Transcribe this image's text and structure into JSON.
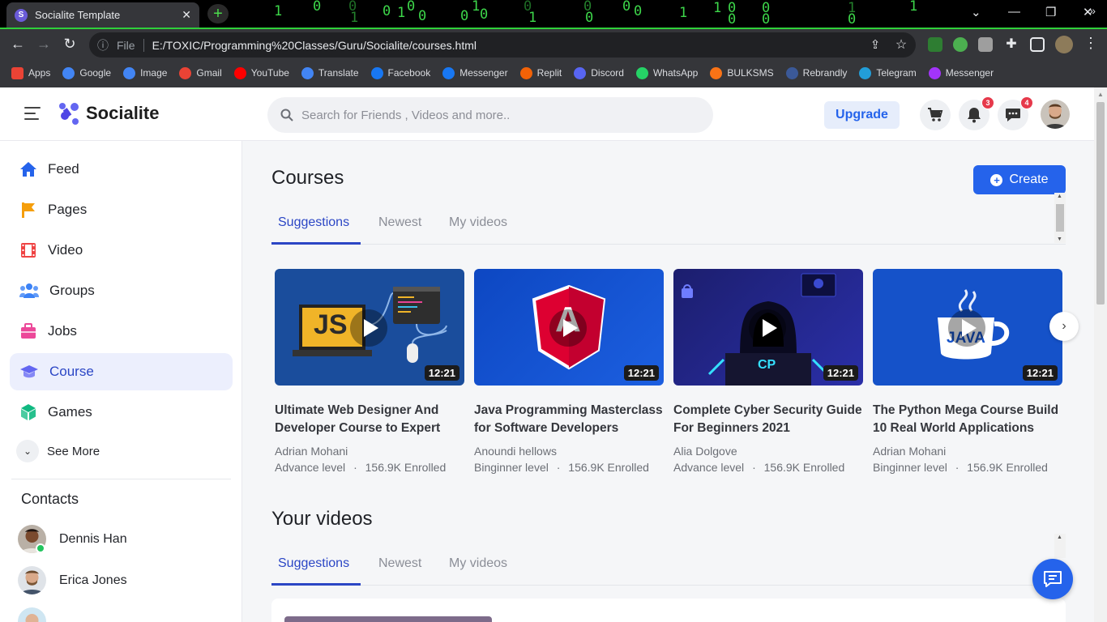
{
  "browser": {
    "tab_title": "Socialite Template",
    "tab_favicon_letter": "S",
    "url_scheme": "File",
    "url": "E:/TOXIC/Programming%20Classes/Guru/Socialite/courses.html",
    "bookmarks": [
      {
        "label": "Apps",
        "color": "#ea4335"
      },
      {
        "label": "Google",
        "color": "#4285f4"
      },
      {
        "label": "Image",
        "color": "#4285f4"
      },
      {
        "label": "Gmail",
        "color": "#ea4335"
      },
      {
        "label": "YouTube",
        "color": "#ff0000"
      },
      {
        "label": "Translate",
        "color": "#4285f4"
      },
      {
        "label": "Facebook",
        "color": "#1877f2"
      },
      {
        "label": "Messenger",
        "color": "#1877f2"
      },
      {
        "label": "Replit",
        "color": "#f26207"
      },
      {
        "label": "Discord",
        "color": "#5865f2"
      },
      {
        "label": "WhatsApp",
        "color": "#25d366"
      },
      {
        "label": "BULKSMS",
        "color": "#f97316"
      },
      {
        "label": "Rebrandly",
        "color": "#3b5998"
      },
      {
        "label": "Telegram",
        "color": "#229ed9"
      },
      {
        "label": "Messenger",
        "color": "#a334fa"
      }
    ],
    "more_glyph": "»"
  },
  "header": {
    "brand": "Socialite",
    "search_placeholder": "Search for Friends , Videos and more..",
    "upgrade_label": "Upgrade",
    "notifications_count": "3",
    "messages_count": "4"
  },
  "sidebar": {
    "items": [
      {
        "label": "Feed",
        "icon": "home-icon",
        "color": "#2563eb"
      },
      {
        "label": "Pages",
        "icon": "flag-icon",
        "color": "#f59e0b"
      },
      {
        "label": "Video",
        "icon": "film-icon",
        "color": "#ef4444"
      },
      {
        "label": "Groups",
        "icon": "users-icon",
        "color": "#3b82f6"
      },
      {
        "label": "Jobs",
        "icon": "briefcase-icon",
        "color": "#ec4899"
      },
      {
        "label": "Course",
        "icon": "graduation-cap-icon",
        "color": "#6366f1"
      },
      {
        "label": "Games",
        "icon": "cube-icon",
        "color": "#10b981"
      }
    ],
    "active_index": 5,
    "see_more_label": "See More",
    "contacts_title": "Contacts",
    "contacts": [
      {
        "name": "Dennis Han",
        "online": true
      },
      {
        "name": "Erica Jones",
        "online": false
      }
    ]
  },
  "main": {
    "courses_title": "Courses",
    "create_label": "Create",
    "tabs": [
      "Suggestions",
      "Newest",
      "My videos"
    ],
    "courses": [
      {
        "title": "Ultimate Web Designer And Developer Course to Expert",
        "author": "Adrian Mohani",
        "level": "Advance level",
        "enrolled": "156.9K Enrolled",
        "duration": "12:21",
        "thumb_text": "JS"
      },
      {
        "title": "Java Programming Masterclass for Software Developers",
        "author": "Anoundi hellows",
        "level": "Binginner level",
        "enrolled": "156.9K Enrolled",
        "duration": "12:21",
        "thumb_text": "A"
      },
      {
        "title": "Complete Cyber Security Guide For Beginners 2021",
        "author": "Alia Dolgove",
        "level": "Advance level",
        "enrolled": "156.9K Enrolled",
        "duration": "12:21",
        "thumb_text": "CP"
      },
      {
        "title": "The Python Mega Course Build 10 Real World Applications",
        "author": "Adrian Mohani",
        "level": "Binginner level",
        "enrolled": "156.9K Enrolled",
        "duration": "12:21",
        "thumb_text": "JAVA"
      }
    ],
    "meta_separator": "·",
    "your_videos_title": "Your videos",
    "your_videos_tabs": [
      "Suggestions",
      "Newest",
      "My videos"
    ]
  },
  "colors": {
    "accent": "#2563eb",
    "active_nav": "#2b46c5",
    "badge": "#e6394b",
    "matrix_green": "#3dd64a"
  }
}
